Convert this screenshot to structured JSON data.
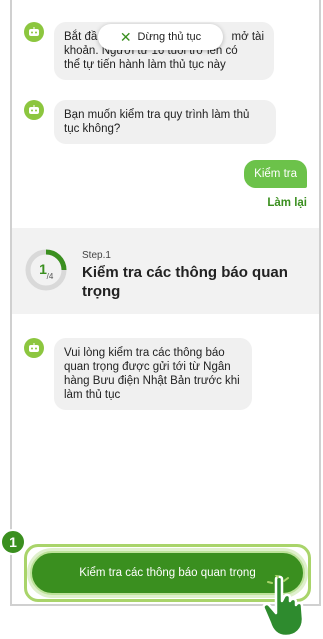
{
  "chat": {
    "msg1": "Bắt đầu thủ tục mở tài khoản. Người từ 16 tuổi trở lên có thể tự tiến hành làm thủ tục này",
    "msg1_visible_start": "Bắt đầ",
    "msg1_visible_end": "mở tài",
    "msg1_line2": "khoản. Người từ 16 tuổi trở lên có",
    "msg1_line3": "thể tự tiến hành làm thủ tục này",
    "msg2": "Bạn muốn kiểm tra quy trình làm thủ tục không?",
    "user_reply": "Kiểm tra",
    "redo": "Làm lại",
    "msg3": "Vui lòng kiểm tra các thông báo quan trọng được gửi tới từ Ngân hàng Bưu điện Nhật Bản trước khi làm thủ tục"
  },
  "stop_button": {
    "label": "Dừng thủ tục"
  },
  "step": {
    "label": "Step.1",
    "title": "Kiểm tra các thông báo quan trọng",
    "current": "1",
    "total": "/4",
    "progress_fraction": 0.25
  },
  "action": {
    "label": "Kiểm tra các thông báo quan trọng"
  },
  "badge": {
    "number": "1"
  },
  "colors": {
    "accent": "#3a8f1f",
    "bot_icon": "#8cc63f",
    "user_bubble": "#6cc24a"
  },
  "icons": [
    "bot-icon",
    "close-icon",
    "pointing-hand-icon"
  ]
}
